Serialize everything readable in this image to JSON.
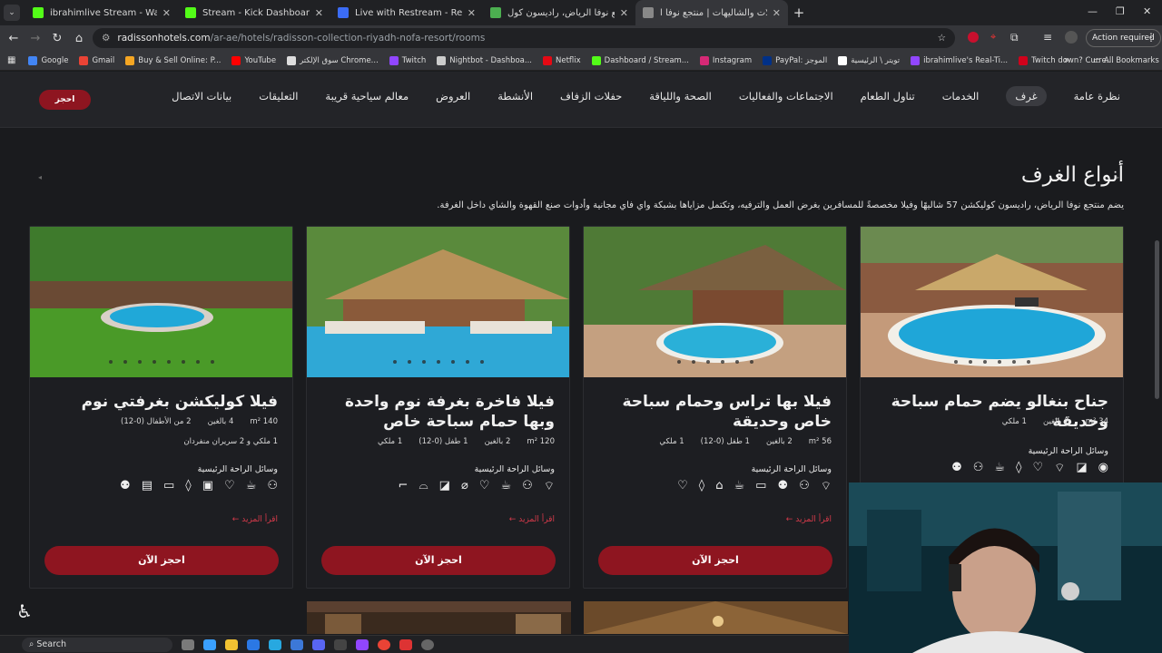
{
  "browser": {
    "tabs": [
      {
        "title": "ibrahimlive Stream - Watch Live",
        "fav": "#53fc18",
        "active": false
      },
      {
        "title": "Stream - Kick Dashboard",
        "fav": "#53fc18",
        "active": false
      },
      {
        "title": "Live with Restream - Restream",
        "fav": "#3b6cf6",
        "active": false
      },
      {
        "title": "منتجع نوفا الرياض، راديسون كول...",
        "fav": "#4caf50",
        "active": false
      },
      {
        "title": "الفيلات والشاليهات | منتجع نوفا ا...",
        "fav": "#888888",
        "active": true
      }
    ],
    "new_tab_symbol": "+",
    "url_host": "radissonhotels.com",
    "url_path": "/ar-ae/hotels/radisson-collection-riyadh-nofa-resort/rooms",
    "action_required": "Action required",
    "bookmarks": [
      {
        "label": "Google",
        "color": "#4285f4"
      },
      {
        "label": "Gmail",
        "color": "#ea4335"
      },
      {
        "label": "Buy & Sell Online: P...",
        "color": "#f5a623"
      },
      {
        "label": "YouTube",
        "color": "#ff0000"
      },
      {
        "label": "سوق الإلكتر Chrome...",
        "color": "#dddddd"
      },
      {
        "label": "Twitch",
        "color": "#9146ff"
      },
      {
        "label": "Nightbot - Dashboa...",
        "color": "#cccccc"
      },
      {
        "label": "Netflix",
        "color": "#e50914"
      },
      {
        "label": "Dashboard / Stream...",
        "color": "#53fc18"
      },
      {
        "label": "Instagram",
        "color": "#d62976"
      },
      {
        "label": "PayPal: الموجز",
        "color": "#003087"
      },
      {
        "label": "تويتر \\ الرئيسية",
        "color": "#ffffff"
      },
      {
        "label": "ibrahimlive's Real-Ti...",
        "color": "#9146ff"
      },
      {
        "label": "Twitch down? Curre...",
        "color": "#d0021b"
      }
    ],
    "all_bookmarks": "All Bookmarks"
  },
  "site": {
    "book_button": "احجز",
    "nav": [
      {
        "label": "نظرة عامة",
        "active": false
      },
      {
        "label": "غرف",
        "active": true
      },
      {
        "label": "الخدمات",
        "active": false
      },
      {
        "label": "تناول الطعام",
        "active": false
      },
      {
        "label": "الاجتماعات والفعاليات",
        "active": false
      },
      {
        "label": "الصحة واللياقة",
        "active": false
      },
      {
        "label": "حفلات الزفاف",
        "active": false
      },
      {
        "label": "الأنشطة",
        "active": false
      },
      {
        "label": "العروض",
        "active": false
      },
      {
        "label": "معالم سياحية قريبة",
        "active": false
      },
      {
        "label": "التعليقات",
        "active": false
      },
      {
        "label": "بيانات الاتصال",
        "active": false
      }
    ],
    "heading": "أنواع الغرف",
    "intro": "يضم منتجع نوفا الرياض، راديسون كوليكشن 57 شاليهًا وفيلا مخصصةً للمسافرين بغرض العمل والترفيه، وتكتمل مزاياها بشبكة واي فاي مجانية وأدوات صنع القهوة والشاي داخل الغرفة."
  },
  "cards": [
    {
      "title": "جناح بنغالو يضم حمام سباحة وحديقة",
      "specs": [
        "34 m²",
        "2 بالغين",
        "1 ملكي"
      ],
      "amenities_label": "وسائل الراحة الرئيسية",
      "icons": [
        "◉",
        "◪",
        "⌔",
        "♡",
        "◊",
        "☕",
        "⚇",
        "⚉"
      ],
      "dots": 6
    },
    {
      "title": "فيلا بها تراس وحمام سباحة خاص وحديقة",
      "specs": [
        "56 m²",
        "2 بالغين",
        "1 طفل (0-12)",
        "1 ملكي"
      ],
      "amenities_label": "وسائل الراحة الرئيسية",
      "icons": [
        "⌔",
        "⚇",
        "⚉",
        "▭",
        "☕",
        "⌂",
        "◊",
        "♡"
      ],
      "read_more": "اقرأ المزيد",
      "book_now": "احجز الآن",
      "dots": 6
    },
    {
      "title": "فيلا فاخرة بغرفة نوم واحدة وبها حمام سباحة خاص",
      "specs": [
        "120 m²",
        "2 بالغين",
        "1 طفل (0-12)",
        "1 ملكي"
      ],
      "amenities_label": "وسائل الراحة الرئيسية",
      "icons": [
        "⌔",
        "⚇",
        "☕",
        "♡",
        "⌀",
        "◪",
        "⌓",
        "⌐"
      ],
      "read_more": "اقرأ المزيد",
      "book_now": "احجز الآن",
      "dots": 7
    },
    {
      "title": "فيلا كوليكشن بغرفتي نوم",
      "specs": [
        "140 m²",
        "4 بالغين",
        "2 من الأطفال (0-12)"
      ],
      "specs2": "1 ملكي و 2 سريران منفردان",
      "amenities_label": "وسائل الراحة الرئيسية",
      "icons": [
        "⚇",
        "☕",
        "♡",
        "▣",
        "◊",
        "▭",
        "▤",
        "⚉"
      ],
      "read_more": "اقرأ المزيد",
      "book_now": "احجز الآن",
      "dots": 8
    }
  ],
  "taskbar": {
    "search": "Search"
  }
}
